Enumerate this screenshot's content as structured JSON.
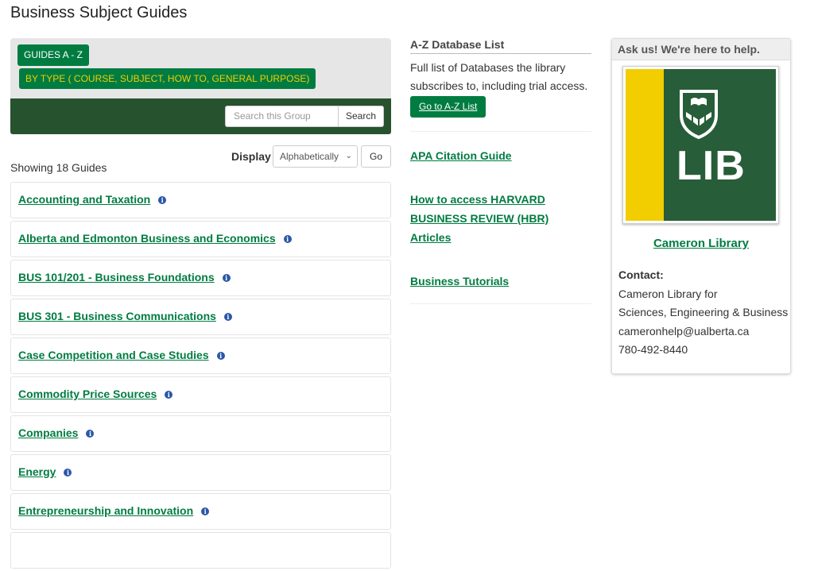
{
  "page_title": "Business Subject Guides",
  "tabs": [
    "GUIDES A - Z",
    "BY TYPE ( COURSE, SUBJECT, HOW TO, GENERAL PURPOSE)"
  ],
  "search": {
    "placeholder": "Search this Group",
    "button": "Search"
  },
  "display": {
    "label": "Display",
    "selected": "Alphabetically",
    "go": "Go"
  },
  "showing": "Showing 18 Guides",
  "guides": [
    "Accounting and Taxation",
    "Alberta and Edmonton Business and Economics",
    "BUS 101/201 - Business Foundations",
    "BUS 301 - Business Communications",
    "Case Competition and Case Studies",
    "Commodity Price Sources",
    "Companies",
    "Energy",
    "Entrepreneurship and Innovation"
  ],
  "az": {
    "heading": "A-Z Database List",
    "text": "Full list of Databases the library subscribes to, including trial access.",
    "button": "Go to A-Z List"
  },
  "links": [
    "APA Citation Guide",
    "How to access HARVARD BUSINESS REVIEW (HBR) Articles",
    "Business Tutorials"
  ],
  "ask": {
    "heading": "Ask us! We're here to help.",
    "logo_text": "LIB",
    "library_name": "Cameron Library",
    "contact_label": "Contact:",
    "contact_lines": [
      "Cameron Library for",
      "Sciences, Engineering & Business",
      "cameronhelp@ualberta.ca",
      "780-492-8440"
    ]
  },
  "colors": {
    "brand_green": "#007c41",
    "dark_green": "#27522e",
    "gold": "#f2cd00",
    "info_blue": "#2a57a8"
  },
  "icons": {
    "info": "info-icon",
    "select": "chevron-down-icon",
    "crest": "university-crest-icon"
  }
}
